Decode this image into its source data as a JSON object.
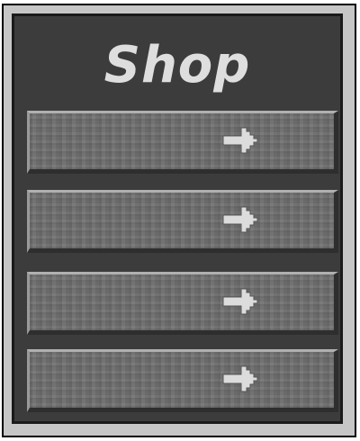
{
  "shop": {
    "title": "Shop",
    "slots": [
      {
        "label": "",
        "icon": "arrow-right-icon"
      },
      {
        "label": "",
        "icon": "arrow-right-icon"
      },
      {
        "label": "",
        "icon": "arrow-right-icon"
      },
      {
        "label": "",
        "icon": "arrow-right-icon"
      }
    ]
  },
  "colors": {
    "frame": "#c6c6c6",
    "panel": "#3c3c3c",
    "slot": "#6f6f6f",
    "title_text": "#dedede",
    "arrow": "#dcdcdc"
  }
}
